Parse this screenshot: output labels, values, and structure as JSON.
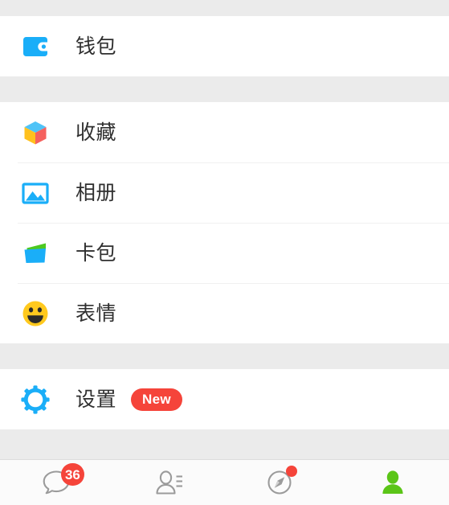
{
  "screen": {
    "name": "wechat-me-menu",
    "background_color": "#ebebeb",
    "panel_color": "#ffffff"
  },
  "menu_groups": [
    {
      "group_name": "wallet-group",
      "items": [
        {
          "id": "wallet",
          "label": "钱包",
          "icon": "wallet-icon",
          "icon_color": "#1aaef8",
          "badge": null
        }
      ]
    },
    {
      "group_name": "content-group",
      "items": [
        {
          "id": "favorites",
          "label": "收藏",
          "icon": "cube-favorites-icon",
          "icon_color": "#4fc3f7",
          "badge": null
        },
        {
          "id": "album",
          "label": "相册",
          "icon": "photo-album-icon",
          "icon_color": "#1aaef8",
          "badge": null
        },
        {
          "id": "cards",
          "label": "卡包",
          "icon": "card-package-icon",
          "icon_color": "#1aaef8",
          "badge": null
        },
        {
          "id": "stickers",
          "label": "表情",
          "icon": "smiley-sticker-icon",
          "icon_color": "#ffc91e",
          "badge": null
        }
      ]
    },
    {
      "group_name": "settings-group",
      "items": [
        {
          "id": "settings",
          "label": "设置",
          "icon": "gear-icon",
          "icon_color": "#1aaef8",
          "badge": "New"
        }
      ]
    }
  ],
  "tabbar": {
    "tabs": [
      {
        "id": "chats",
        "icon": "chat-bubble-icon",
        "active": false,
        "badge_count": "36",
        "badge_type": "count"
      },
      {
        "id": "contacts",
        "icon": "contacts-person-icon",
        "active": false,
        "badge_count": null,
        "badge_type": null
      },
      {
        "id": "discover",
        "icon": "compass-discover-icon",
        "active": false,
        "badge_count": null,
        "badge_type": "dot"
      },
      {
        "id": "me",
        "icon": "person-me-icon",
        "active": true,
        "badge_count": null,
        "badge_type": null
      }
    ],
    "active_color": "#5bc518",
    "inactive_color": "#9b9b9b",
    "badge_color": "#f5443a"
  }
}
